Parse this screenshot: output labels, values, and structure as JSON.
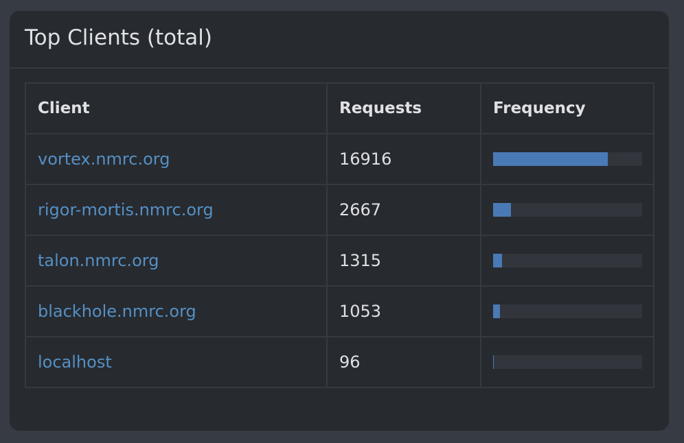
{
  "panel": {
    "title": "Top Clients (total)"
  },
  "table": {
    "headers": {
      "client": "Client",
      "requests": "Requests",
      "frequency": "Frequency"
    },
    "rows": [
      {
        "client": "vortex.nmrc.org",
        "requests": "16916",
        "frequency_fraction": 0.77
      },
      {
        "client": "rigor-mortis.nmrc.org",
        "requests": "2667",
        "frequency_fraction": 0.122
      },
      {
        "client": "talon.nmrc.org",
        "requests": "1315",
        "frequency_fraction": 0.06
      },
      {
        "client": "blackhole.nmrc.org",
        "requests": "1053",
        "frequency_fraction": 0.048
      },
      {
        "client": "localhost",
        "requests": "96",
        "frequency_fraction": 0.004
      }
    ]
  },
  "colors": {
    "link": "#5590c4",
    "bar_fill": "#4a7ab5",
    "bar_track": "#32363c"
  }
}
